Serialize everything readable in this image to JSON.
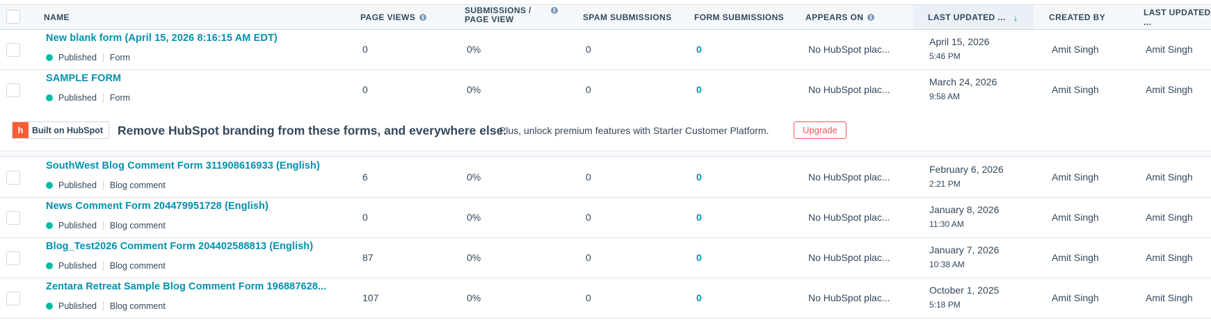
{
  "columns": {
    "name": "NAME",
    "page_views": "PAGE VIEWS",
    "submissions_line1": "SUBMISSIONS /",
    "submissions_line2": "PAGE VIEW",
    "spam": "SPAM SUBMISSIONS",
    "form_submissions": "FORM SUBMISSIONS",
    "appears_on": "APPEARS ON",
    "last_updated": "LAST UPDATED ...",
    "created_by": "CREATED BY",
    "last_updated_by": "LAST UPDATED ..."
  },
  "sort_arrow": "↓",
  "rows_top": [
    {
      "name": "New blank form (April 15, 2026 8:16:15 AM EDT)",
      "status": "Published",
      "type": "Form",
      "page_views": "0",
      "rate": "0%",
      "spam": "0",
      "submissions": "0",
      "appears_on": "No HubSpot plac...",
      "date": "April 15, 2026",
      "time": "5:46 PM",
      "created_by": "Amit Singh",
      "updated_by": "Amit Singh"
    },
    {
      "name": "SAMPLE FORM",
      "status": "Published",
      "type": "Form",
      "page_views": "0",
      "rate": "0%",
      "spam": "0",
      "submissions": "0",
      "appears_on": "No HubSpot plac...",
      "date": "March 24, 2026",
      "time": "9:58 AM",
      "created_by": "Amit Singh",
      "updated_by": "Amit Singh"
    }
  ],
  "banner": {
    "badge_logo": "h",
    "badge_text": "Built on HubSpot",
    "title": "Remove HubSpot branding from these forms, and everywhere else.",
    "text": "Plus, unlock premium features with Starter Customer Platform.",
    "button": "Upgrade"
  },
  "rows_bottom": [
    {
      "name": "SouthWest Blog Comment Form 311908616933 (English)",
      "status": "Published",
      "type": "Blog comment",
      "page_views": "6",
      "rate": "0%",
      "spam": "0",
      "submissions": "0",
      "appears_on": "No HubSpot plac...",
      "date": "February 6, 2026",
      "time": "2:21 PM",
      "created_by": "Amit Singh",
      "updated_by": "Amit Singh"
    },
    {
      "name": "News Comment Form 204479951728 (English)",
      "status": "Published",
      "type": "Blog comment",
      "page_views": "0",
      "rate": "0%",
      "spam": "0",
      "submissions": "0",
      "appears_on": "No HubSpot plac...",
      "date": "January 8, 2026",
      "time": "11:30 AM",
      "created_by": "Amit Singh",
      "updated_by": "Amit Singh"
    },
    {
      "name": "Blog_Test2026 Comment Form 204402588813 (English)",
      "status": "Published",
      "type": "Blog comment",
      "page_views": "87",
      "rate": "0%",
      "spam": "0",
      "submissions": "0",
      "appears_on": "No HubSpot plac...",
      "date": "January 7, 2026",
      "time": "10:38 AM",
      "created_by": "Amit Singh",
      "updated_by": "Amit Singh"
    },
    {
      "name": "Zentara Retreat Sample Blog Comment Form 196887628...",
      "status": "Published",
      "type": "Blog comment",
      "page_views": "107",
      "rate": "0%",
      "spam": "0",
      "submissions": "0",
      "appears_on": "No HubSpot plac...",
      "date": "October 1, 2025",
      "time": "5:18 PM",
      "created_by": "Amit Singh",
      "updated_by": "Amit Singh"
    }
  ],
  "colors": {
    "accent": "#0091ae",
    "published": "#00bda5",
    "upgrade": "#f2545b",
    "hubspot_orange": "#ff5c35"
  }
}
